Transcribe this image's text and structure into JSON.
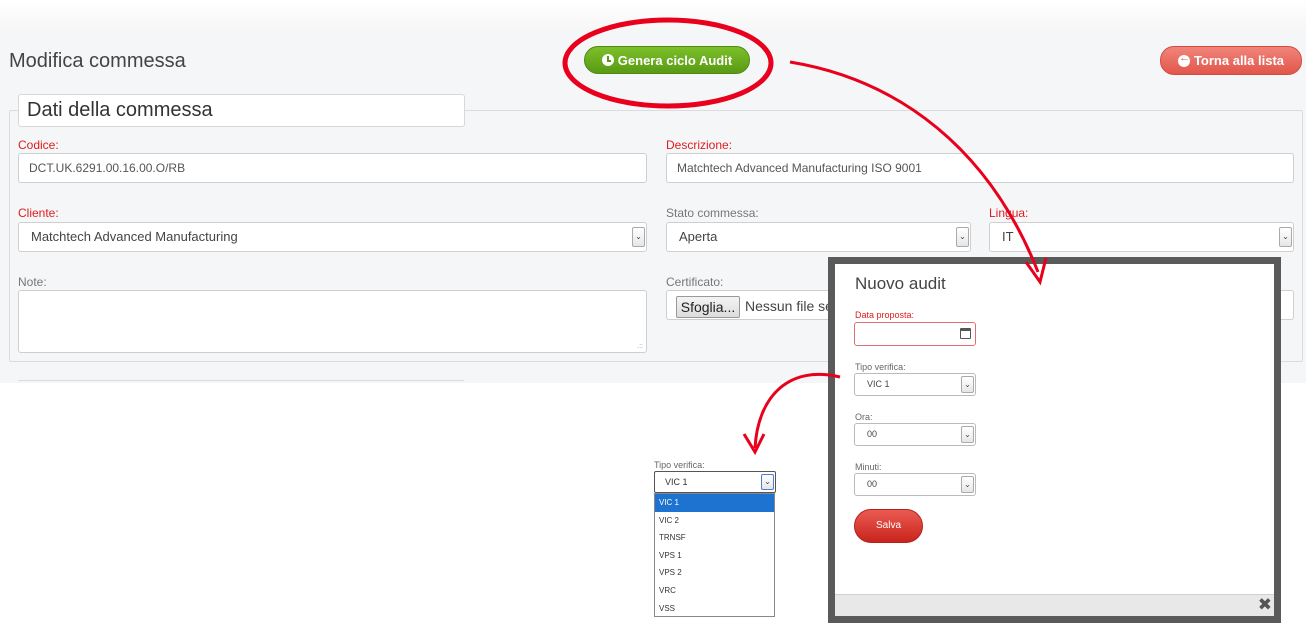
{
  "header": {
    "title": "Modifica commessa",
    "generate_button": "Genera ciclo Audit",
    "back_button": "Torna alla lista"
  },
  "section": {
    "legend": "Dati della commessa",
    "codice": {
      "label": "Codice:",
      "value": "DCT.UK.6291.00.16.00.O/RB"
    },
    "descrizione": {
      "label": "Descrizione:",
      "value": "Matchtech Advanced Manufacturing ISO 9001"
    },
    "cliente": {
      "label": "Cliente:",
      "value": "Matchtech Advanced Manufacturing"
    },
    "stato": {
      "label": "Stato commessa:",
      "value": "Aperta"
    },
    "lingua": {
      "label": "Lingua:",
      "value": "IT"
    },
    "note": {
      "label": "Note:"
    },
    "certificato": {
      "label": "Certificato:",
      "button": "Sfoglia...",
      "status": "Nessun file sele"
    }
  },
  "dropdown_preview": {
    "label": "Tipo verifica:",
    "selected": "VIC 1",
    "options": [
      "VIC 1",
      "VIC 2",
      "TRNSF",
      "VPS 1",
      "VPS 2",
      "VRC",
      "VSS"
    ]
  },
  "modal": {
    "title": "Nuovo audit",
    "data_proposta_label": "Data proposta:",
    "tipo_verifica_label": "Tipo verifica:",
    "tipo_verifica_value": "VIC 1",
    "ora_label": "Ora:",
    "ora_value": "00",
    "minuti_label": "Minuti:",
    "minuti_value": "00",
    "save_button": "Salva",
    "close_glyph": "✖"
  },
  "colors": {
    "accent_green": "#6aad1f",
    "accent_red": "#e2564a",
    "required_label": "#e01c1c",
    "annotation_red": "#e8001c",
    "selected_option": "#1e73d0"
  },
  "icons": [
    "clock-icon",
    "arrow-left-circle-icon",
    "chevron-down-icon",
    "calendar-icon",
    "close-icon"
  ]
}
